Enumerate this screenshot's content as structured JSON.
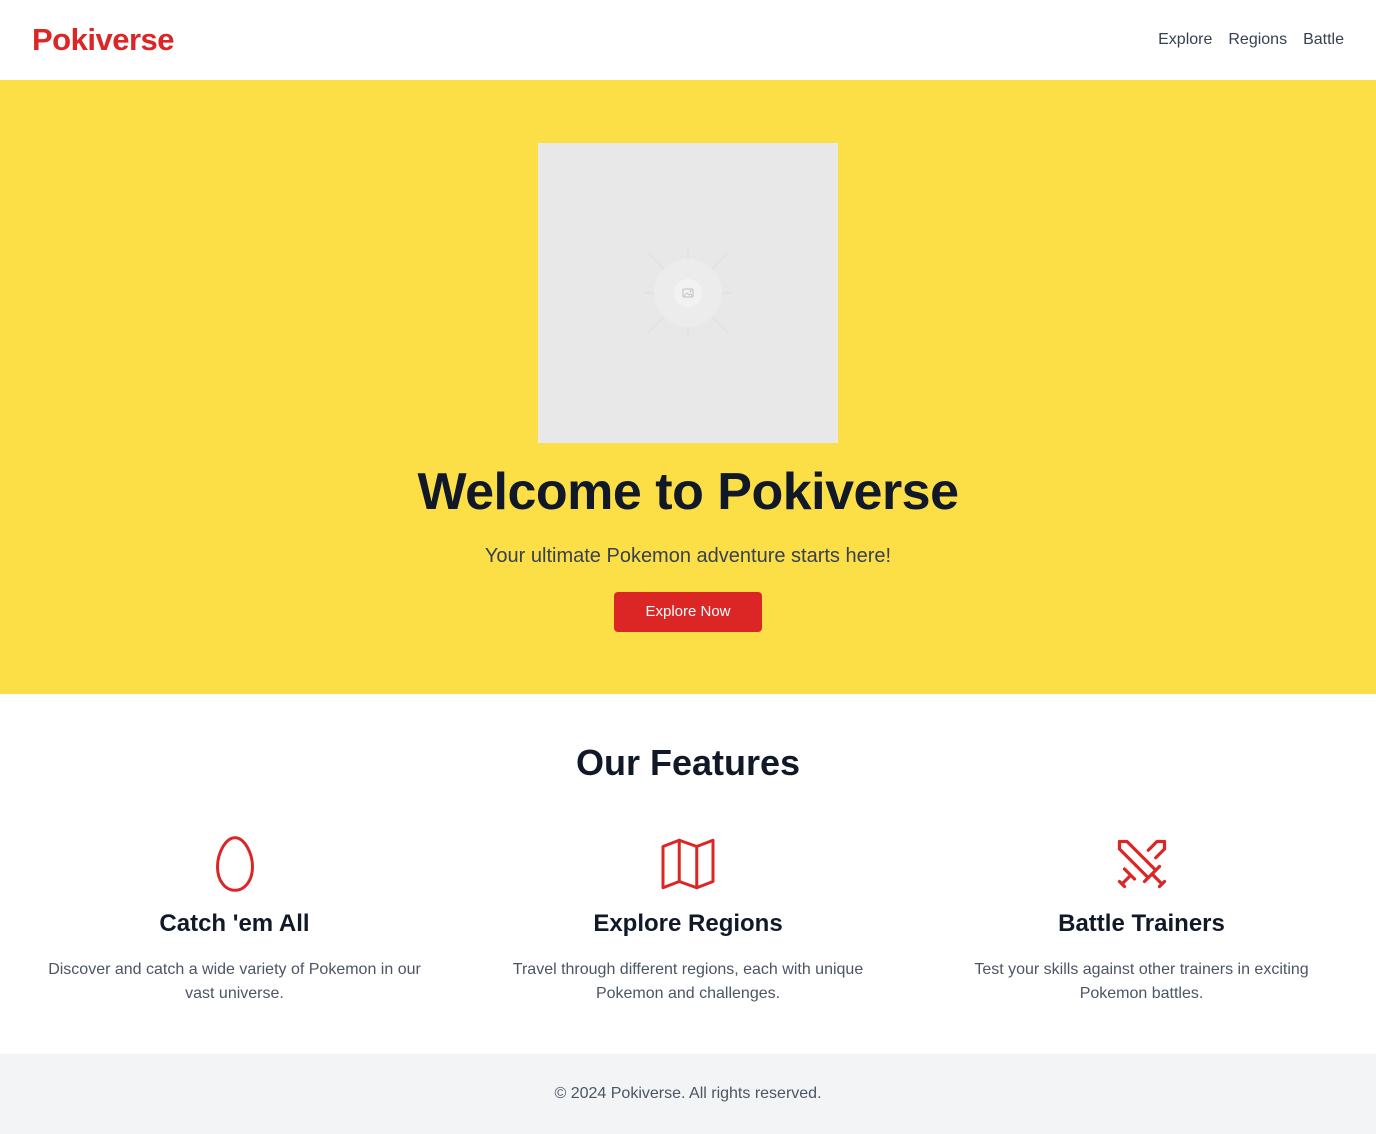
{
  "header": {
    "logo": "Pokiverse",
    "nav": [
      {
        "label": "Explore"
      },
      {
        "label": "Regions"
      },
      {
        "label": "Battle"
      }
    ]
  },
  "hero": {
    "image_icon": "image-placeholder-icon",
    "title": "Welcome to Pokiverse",
    "subtitle": "Your ultimate Pokemon adventure starts here!",
    "cta_label": "Explore Now"
  },
  "features": {
    "title": "Our Features",
    "items": [
      {
        "icon": "egg-icon",
        "title": "Catch 'em All",
        "desc": "Discover and catch a wide variety of Pokemon in our vast universe."
      },
      {
        "icon": "map-icon",
        "title": "Explore Regions",
        "desc": "Travel through different regions, each with unique Pokemon and challenges."
      },
      {
        "icon": "crossed-swords-icon",
        "title": "Battle Trainers",
        "desc": "Test your skills against other trainers in exciting Pokemon battles."
      }
    ]
  },
  "footer": {
    "text": "© 2024 Pokiverse. All rights reserved."
  },
  "colors": {
    "brand": "#dc2626",
    "hero_bg": "#fcdf47",
    "footer_bg": "#f3f4f6"
  }
}
